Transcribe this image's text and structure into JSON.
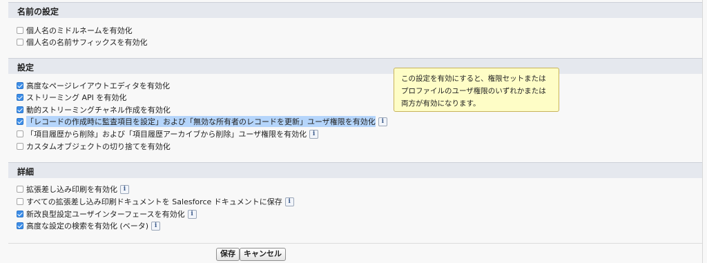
{
  "sections": {
    "name": {
      "title": "名前の設定",
      "items": [
        {
          "label": "個人名のミドルネームを有効化",
          "checked": false
        },
        {
          "label": "個人名の名前サフィックスを有効化",
          "checked": false
        }
      ]
    },
    "settings": {
      "title": "設定",
      "items": [
        {
          "label": "高度なページレイアウトエディタを有効化",
          "checked": true
        },
        {
          "label": "ストリーミング API を有効化",
          "checked": true
        },
        {
          "label": "動的ストリーミングチャネル作成を有効化",
          "checked": true
        },
        {
          "label": "「レコードの作成時に監査項目を設定」および「無効な所有者のレコードを更新」ユーザ権限を有効化",
          "checked": true
        },
        {
          "label": "「項目履歴から削除」および「項目履歴アーカイブから削除」ユーザ権限を有効化",
          "checked": false
        },
        {
          "label": "カスタムオブジェクトの切り捨てを有効化",
          "checked": false
        }
      ]
    },
    "details": {
      "title": "詳細",
      "items": [
        {
          "label": "拡張差し込み印刷を有効化",
          "checked": false
        },
        {
          "label": "すべての拡張差し込み印刷ドキュメントを Salesforce ドキュメントに保存",
          "checked": false
        },
        {
          "label": "新改良型設定ユーザインターフェースを有効化",
          "checked": true
        },
        {
          "label": "高度な設定の検索を有効化 (ベータ)",
          "checked": true
        }
      ]
    }
  },
  "info_icon_glyph": "i",
  "tooltip": {
    "text": "この設定を有効にすると、権限セットまたは\nプロファイルのユーザ権限のいずれかまたは\n両方が有効になります。"
  },
  "buttons": {
    "save": "保存",
    "cancel": "キャンセル"
  },
  "colors": {
    "section_header_bg": "#e5e8ee",
    "checkbox_checked": "#3d8ee8",
    "highlight": "#b5d5fb",
    "tooltip_bg": "#fefdc6"
  }
}
